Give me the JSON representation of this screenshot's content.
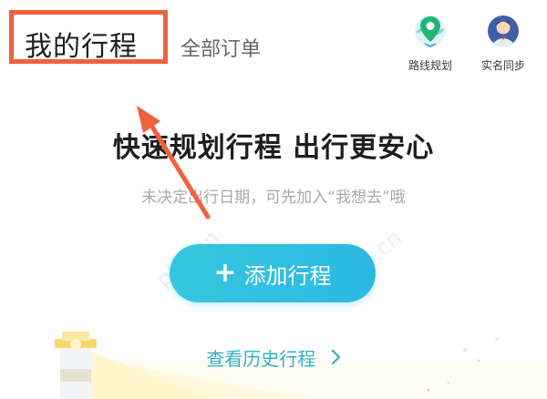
{
  "header": {
    "tabs": [
      {
        "label": "我的行程",
        "active": true
      },
      {
        "label": "全部订单",
        "active": false
      }
    ],
    "actions": [
      {
        "label": "路线规划",
        "icon": "map-pin-icon"
      },
      {
        "label": "实名同步",
        "icon": "user-avatar-icon"
      }
    ]
  },
  "hero": {
    "headline": "快速规划行程 出行更安心",
    "subline": "未决定出行日期，可先加入“我想去”哦"
  },
  "add_button": {
    "label": "添加行程",
    "icon": "plus-icon"
  },
  "history_link": {
    "label": "查看历史行程",
    "icon": "chevron-right-icon"
  },
  "colors": {
    "accent": "#2eb2c9",
    "button_start": "#37c7dd",
    "button_end": "#2bb8e3",
    "annotation": "#f0623d"
  }
}
